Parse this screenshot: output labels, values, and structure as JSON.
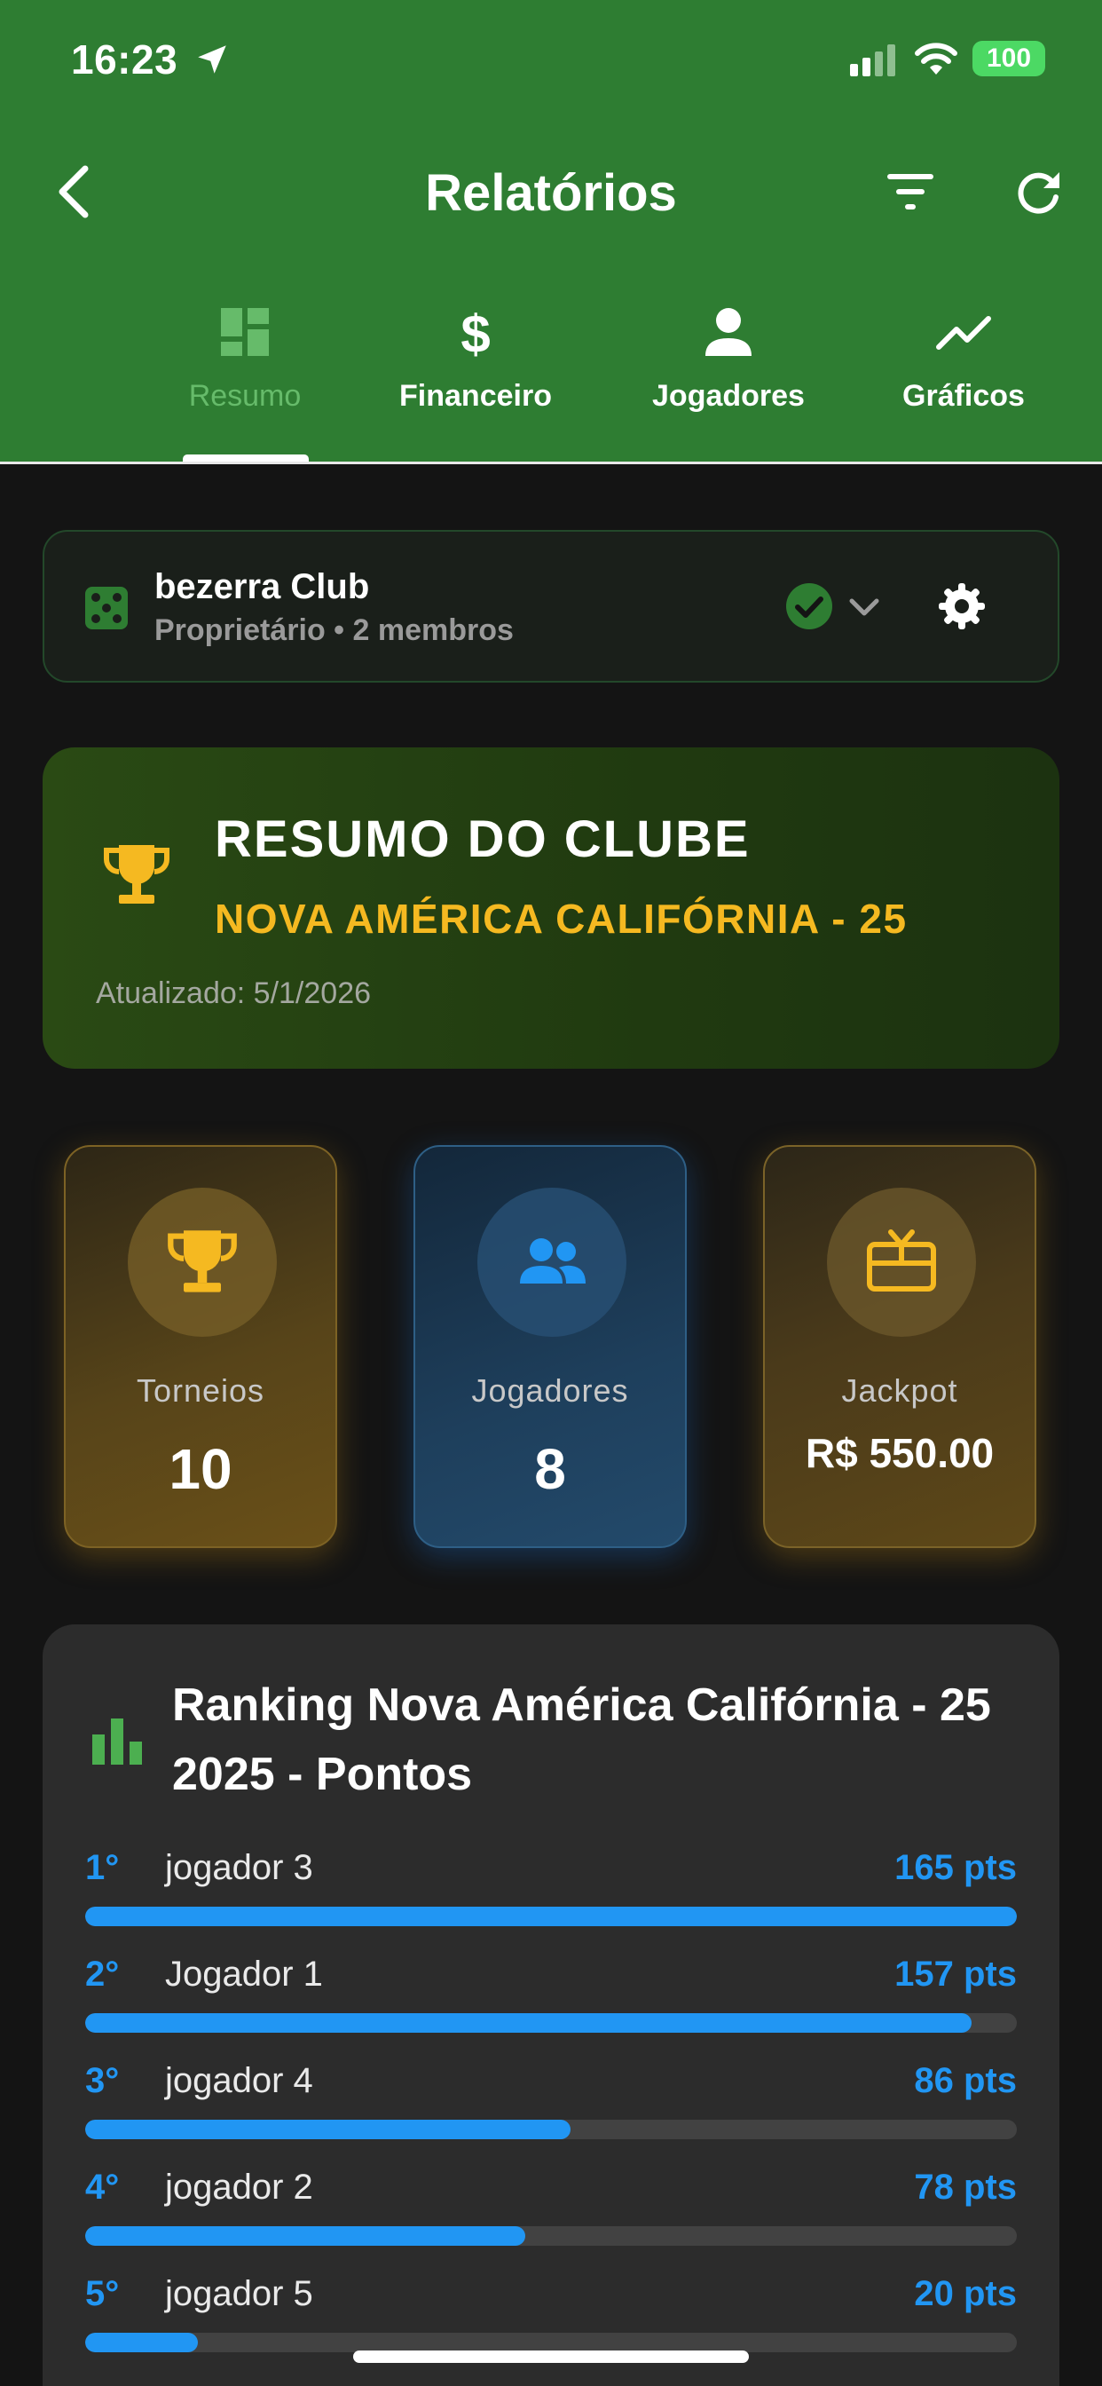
{
  "status_bar": {
    "time": "16:23",
    "battery": "100"
  },
  "header": {
    "title": "Relatórios"
  },
  "tabs": [
    {
      "label": "Resumo",
      "icon": "dashboard-icon",
      "active": true
    },
    {
      "label": "Financeiro",
      "icon": "dollar-icon",
      "active": false
    },
    {
      "label": "Jogadores",
      "icon": "person-icon",
      "active": false
    },
    {
      "label": "Gráficos",
      "icon": "trending-up-icon",
      "active": false
    }
  ],
  "club": {
    "name": "bezerra Club",
    "meta": "Proprietário • 2 membros"
  },
  "summary": {
    "title": "RESUMO DO CLUBE",
    "subtitle": "NOVA AMÉRICA CALIFÓRNIA - 25",
    "updated": "Atualizado: 5/1/2026"
  },
  "stats": [
    {
      "label": "Torneios",
      "value": "10"
    },
    {
      "label": "Jogadores",
      "value": "8"
    },
    {
      "label": "Jackpot",
      "value": "R$ 550.00"
    }
  ],
  "ranking": {
    "title": "Ranking Nova América Califórnia - 25 2025 - Pontos",
    "max_points": 165,
    "rows": [
      {
        "position": "1°",
        "name": "jogador 3",
        "points_label": "165 pts",
        "points": 165
      },
      {
        "position": "2°",
        "name": "Jogador 1",
        "points_label": "157 pts",
        "points": 157
      },
      {
        "position": "3°",
        "name": "jogador 4",
        "points_label": "86 pts",
        "points": 86
      },
      {
        "position": "4°",
        "name": "jogador 2",
        "points_label": "78 pts",
        "points": 78
      },
      {
        "position": "5°",
        "name": "jogador 5",
        "points_label": "20 pts",
        "points": 20
      }
    ]
  },
  "colors": {
    "header_green": "#2e7d32",
    "accent_gold": "#f5b921",
    "accent_blue": "#2196f3",
    "active_tab_green": "#66bb6a"
  }
}
